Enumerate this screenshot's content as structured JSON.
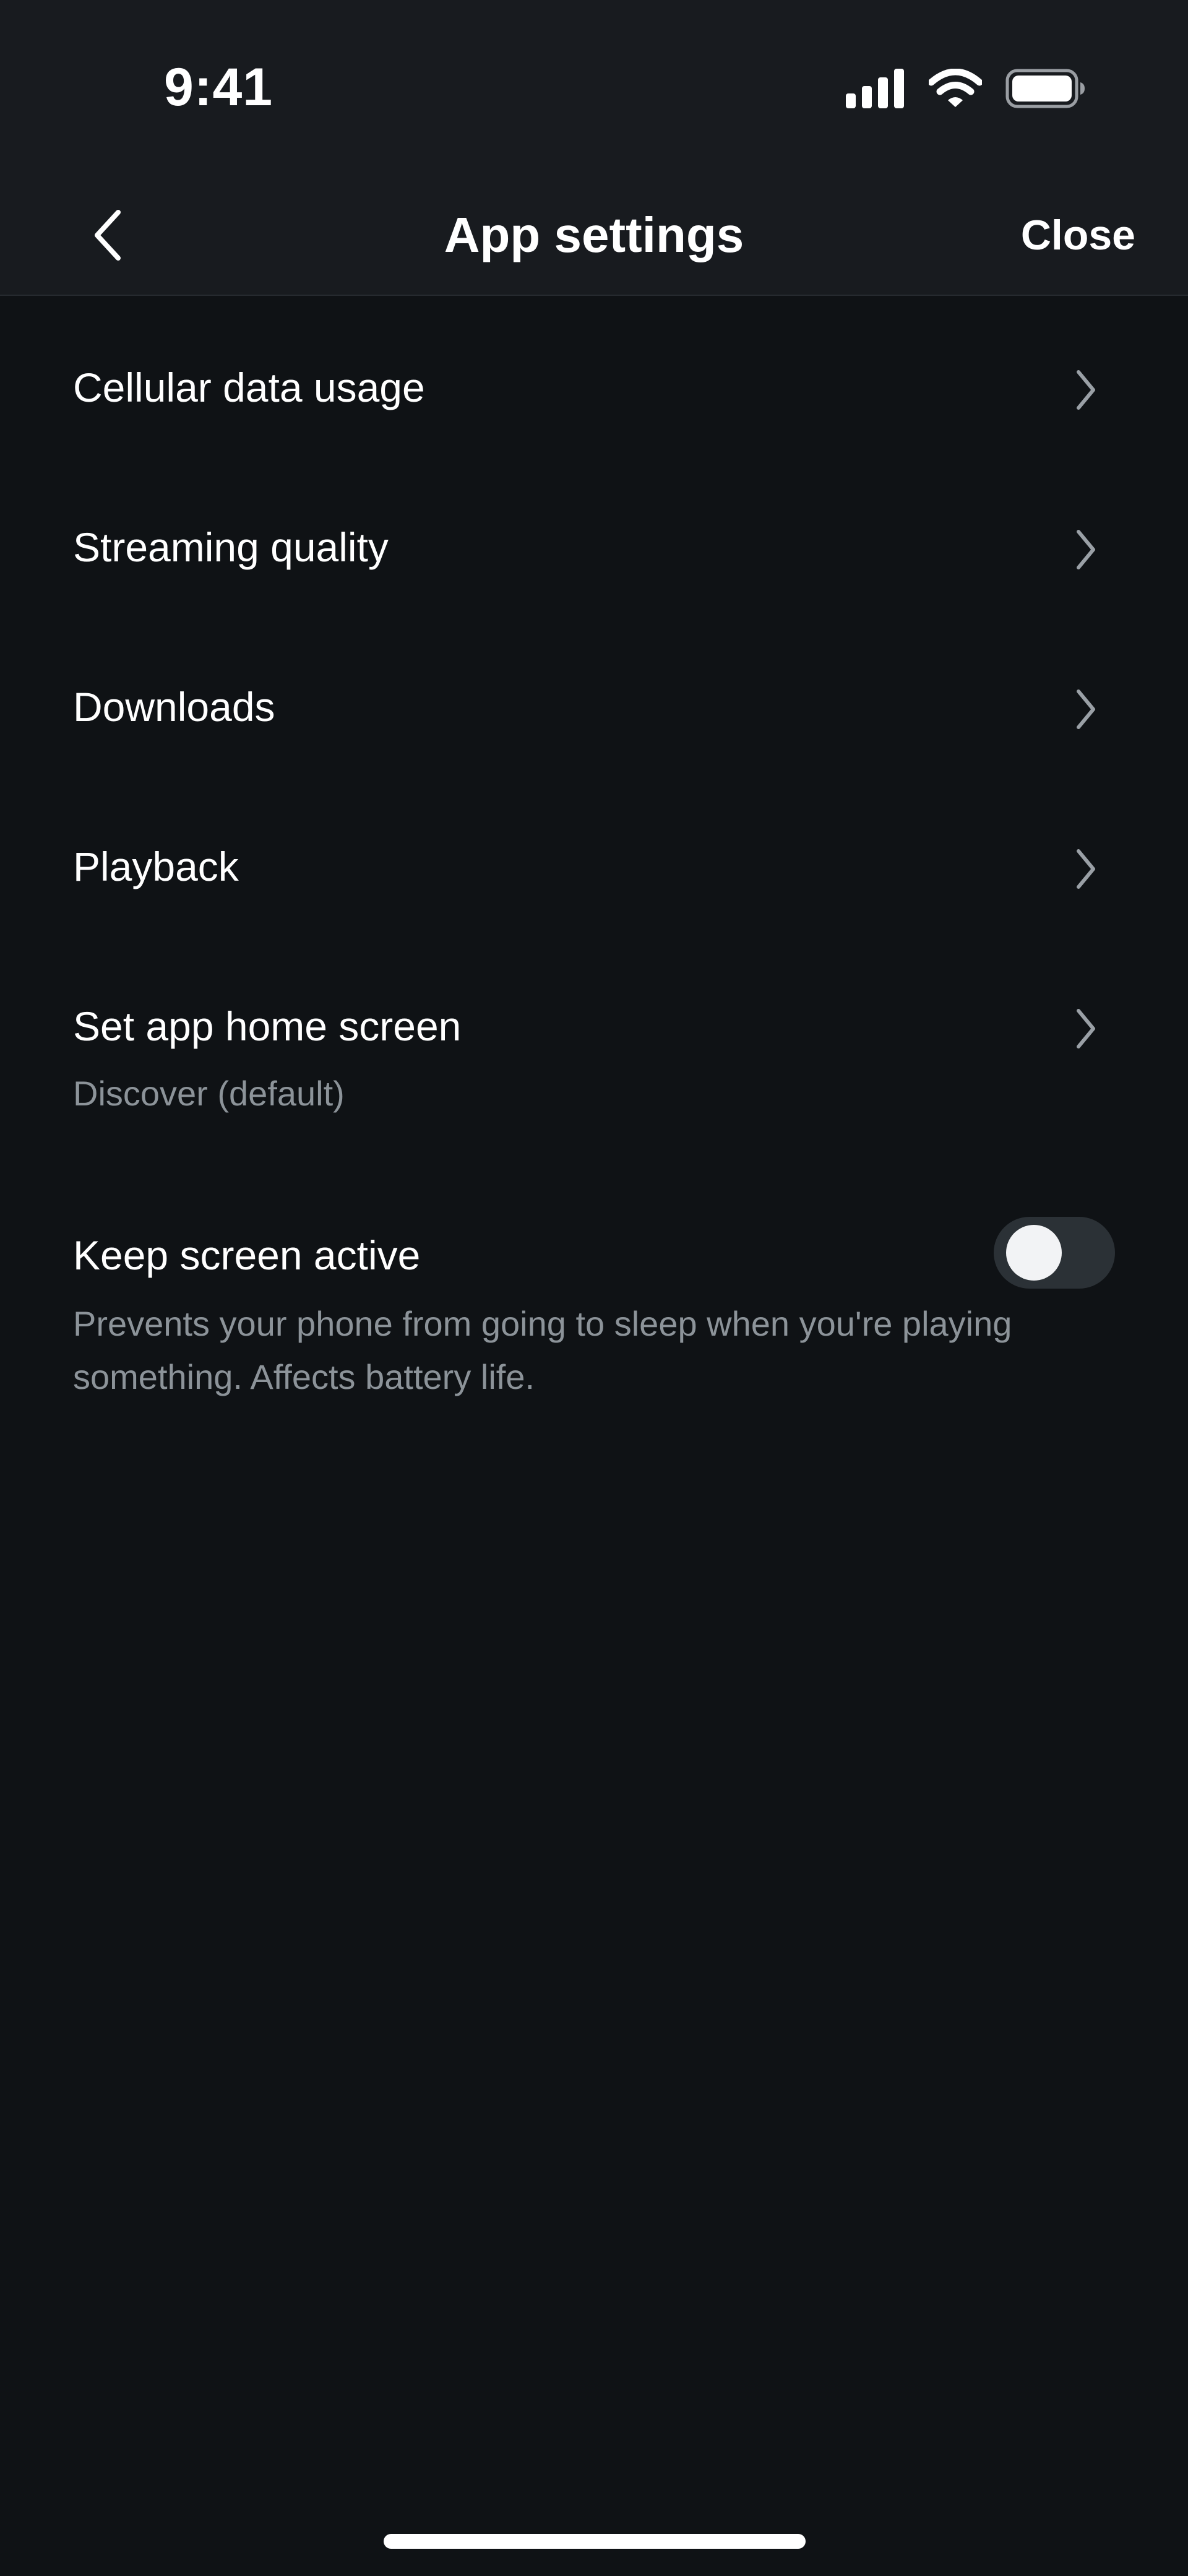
{
  "status_bar": {
    "time": "9:41",
    "icons": [
      "cellular-signal-icon",
      "wifi-icon",
      "battery-icon"
    ]
  },
  "header": {
    "title": "App settings",
    "close_label": "Close",
    "back_icon": "chevron-left-icon"
  },
  "settings": {
    "items": [
      {
        "label": "Cellular data usage",
        "icon": "chevron-right-icon"
      },
      {
        "label": "Streaming quality",
        "icon": "chevron-right-icon"
      },
      {
        "label": "Downloads",
        "icon": "chevron-right-icon"
      },
      {
        "label": "Playback",
        "icon": "chevron-right-icon"
      },
      {
        "label": "Set app home screen",
        "sublabel": "Discover (default)",
        "icon": "chevron-right-icon"
      }
    ],
    "keep_screen_active": {
      "label": "Keep screen active",
      "description": "Prevents your phone from going to sleep when you're playing something. Affects battery life.",
      "enabled": false
    }
  },
  "colors": {
    "background": "#0f1215",
    "header_background": "#181b1f",
    "text_primary": "#ffffff",
    "text_secondary": "#8c9399",
    "toggle_track_off": "#2b3136",
    "toggle_knob": "#f2f3f5"
  }
}
